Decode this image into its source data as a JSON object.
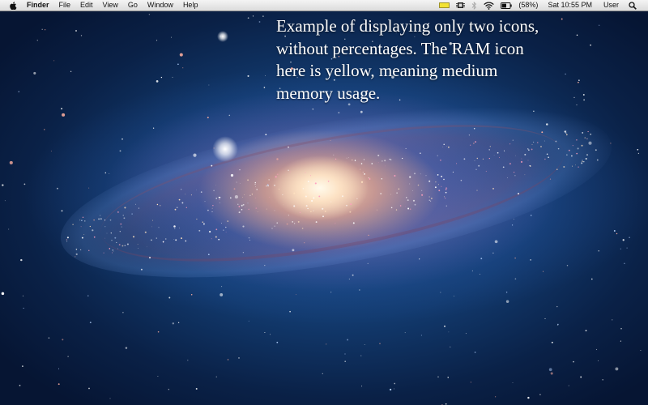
{
  "menu_bar": {
    "apple_icon": "apple-logo-icon",
    "app_name": "Finder",
    "menus": [
      "File",
      "Edit",
      "View",
      "Go",
      "Window",
      "Help"
    ],
    "status": {
      "ram_icon": "ram-meter-icon",
      "ram_color": "#f2e233",
      "cpu_icon": "cpu-chip-icon",
      "bluetooth_icon": "bluetooth-icon",
      "wifi_icon": "wifi-icon",
      "battery_icon": "battery-icon",
      "battery_percent": "(58%)",
      "battery_level": 0.58,
      "clock": "Sat 10:55 PM",
      "user": "User",
      "spotlight_icon": "spotlight-search-icon"
    }
  },
  "caption": {
    "lines": [
      "Example of displaying only two icons,",
      "without percentages. The RAM icon",
      "here is yellow, meaning medium",
      "memory usage."
    ]
  }
}
